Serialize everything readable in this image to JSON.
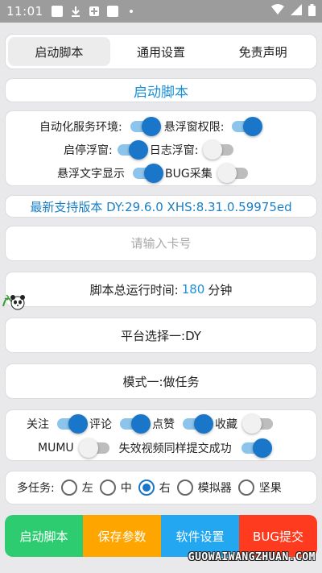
{
  "status_bar": {
    "time": "11:01"
  },
  "tabs": [
    {
      "label": "启动脚本",
      "active": true
    },
    {
      "label": "通用设置",
      "active": false
    },
    {
      "label": "免责声明",
      "active": false
    }
  ],
  "section_title": "启动脚本",
  "toggles": {
    "automation_env": {
      "label": "自动化服务环境:",
      "on": true
    },
    "float_permission": {
      "label": "悬浮窗权限:",
      "on": true
    },
    "start_stop_float": {
      "label": "启停浮窗:",
      "on": true
    },
    "log_float": {
      "label": "日志浮窗:",
      "on": false
    },
    "float_text": {
      "label": "悬浮文字显示",
      "on": true
    },
    "bug_collect": {
      "label": "BUG采集",
      "on": false
    }
  },
  "version_text": "最新支持版本 DY:29.6.0 XHS:8.31.0.59975ed",
  "card_input": {
    "placeholder": "请输入卡号",
    "value": ""
  },
  "runtime": {
    "prefix": "脚本总运行时间:",
    "value": "180",
    "unit": "分钟"
  },
  "platform_button": "平台选择一:DY",
  "mode_button": "模式一:做任务",
  "task_options": {
    "follow": {
      "label": "关注",
      "on": true
    },
    "comment": {
      "label": "评论",
      "on": true
    },
    "like": {
      "label": "点赞",
      "on": true
    },
    "favorite": {
      "label": "收藏",
      "on": false
    },
    "mumu": {
      "label": "MUMU",
      "on": false
    },
    "invalid_video": {
      "label": "失效视频同样提交成功",
      "on": true
    }
  },
  "multitask": {
    "label": "多任务:",
    "options": [
      "左",
      "中",
      "右",
      "模拟器",
      "坚果"
    ],
    "selected": "右"
  },
  "bottom_buttons": {
    "start": {
      "label": "启动脚本",
      "color": "#2ecc71"
    },
    "save": {
      "label": "保存参数",
      "color": "#ffa500"
    },
    "settings": {
      "label": "软件设置",
      "color": "#22a7f0"
    },
    "bug": {
      "label": "BUG提交",
      "color": "#ff3b1f"
    }
  },
  "colors": {
    "accent": "#1976c8",
    "title_blue": "#1a8fd8"
  },
  "watermark": "GUOWAIWANGZHUAN.COM"
}
